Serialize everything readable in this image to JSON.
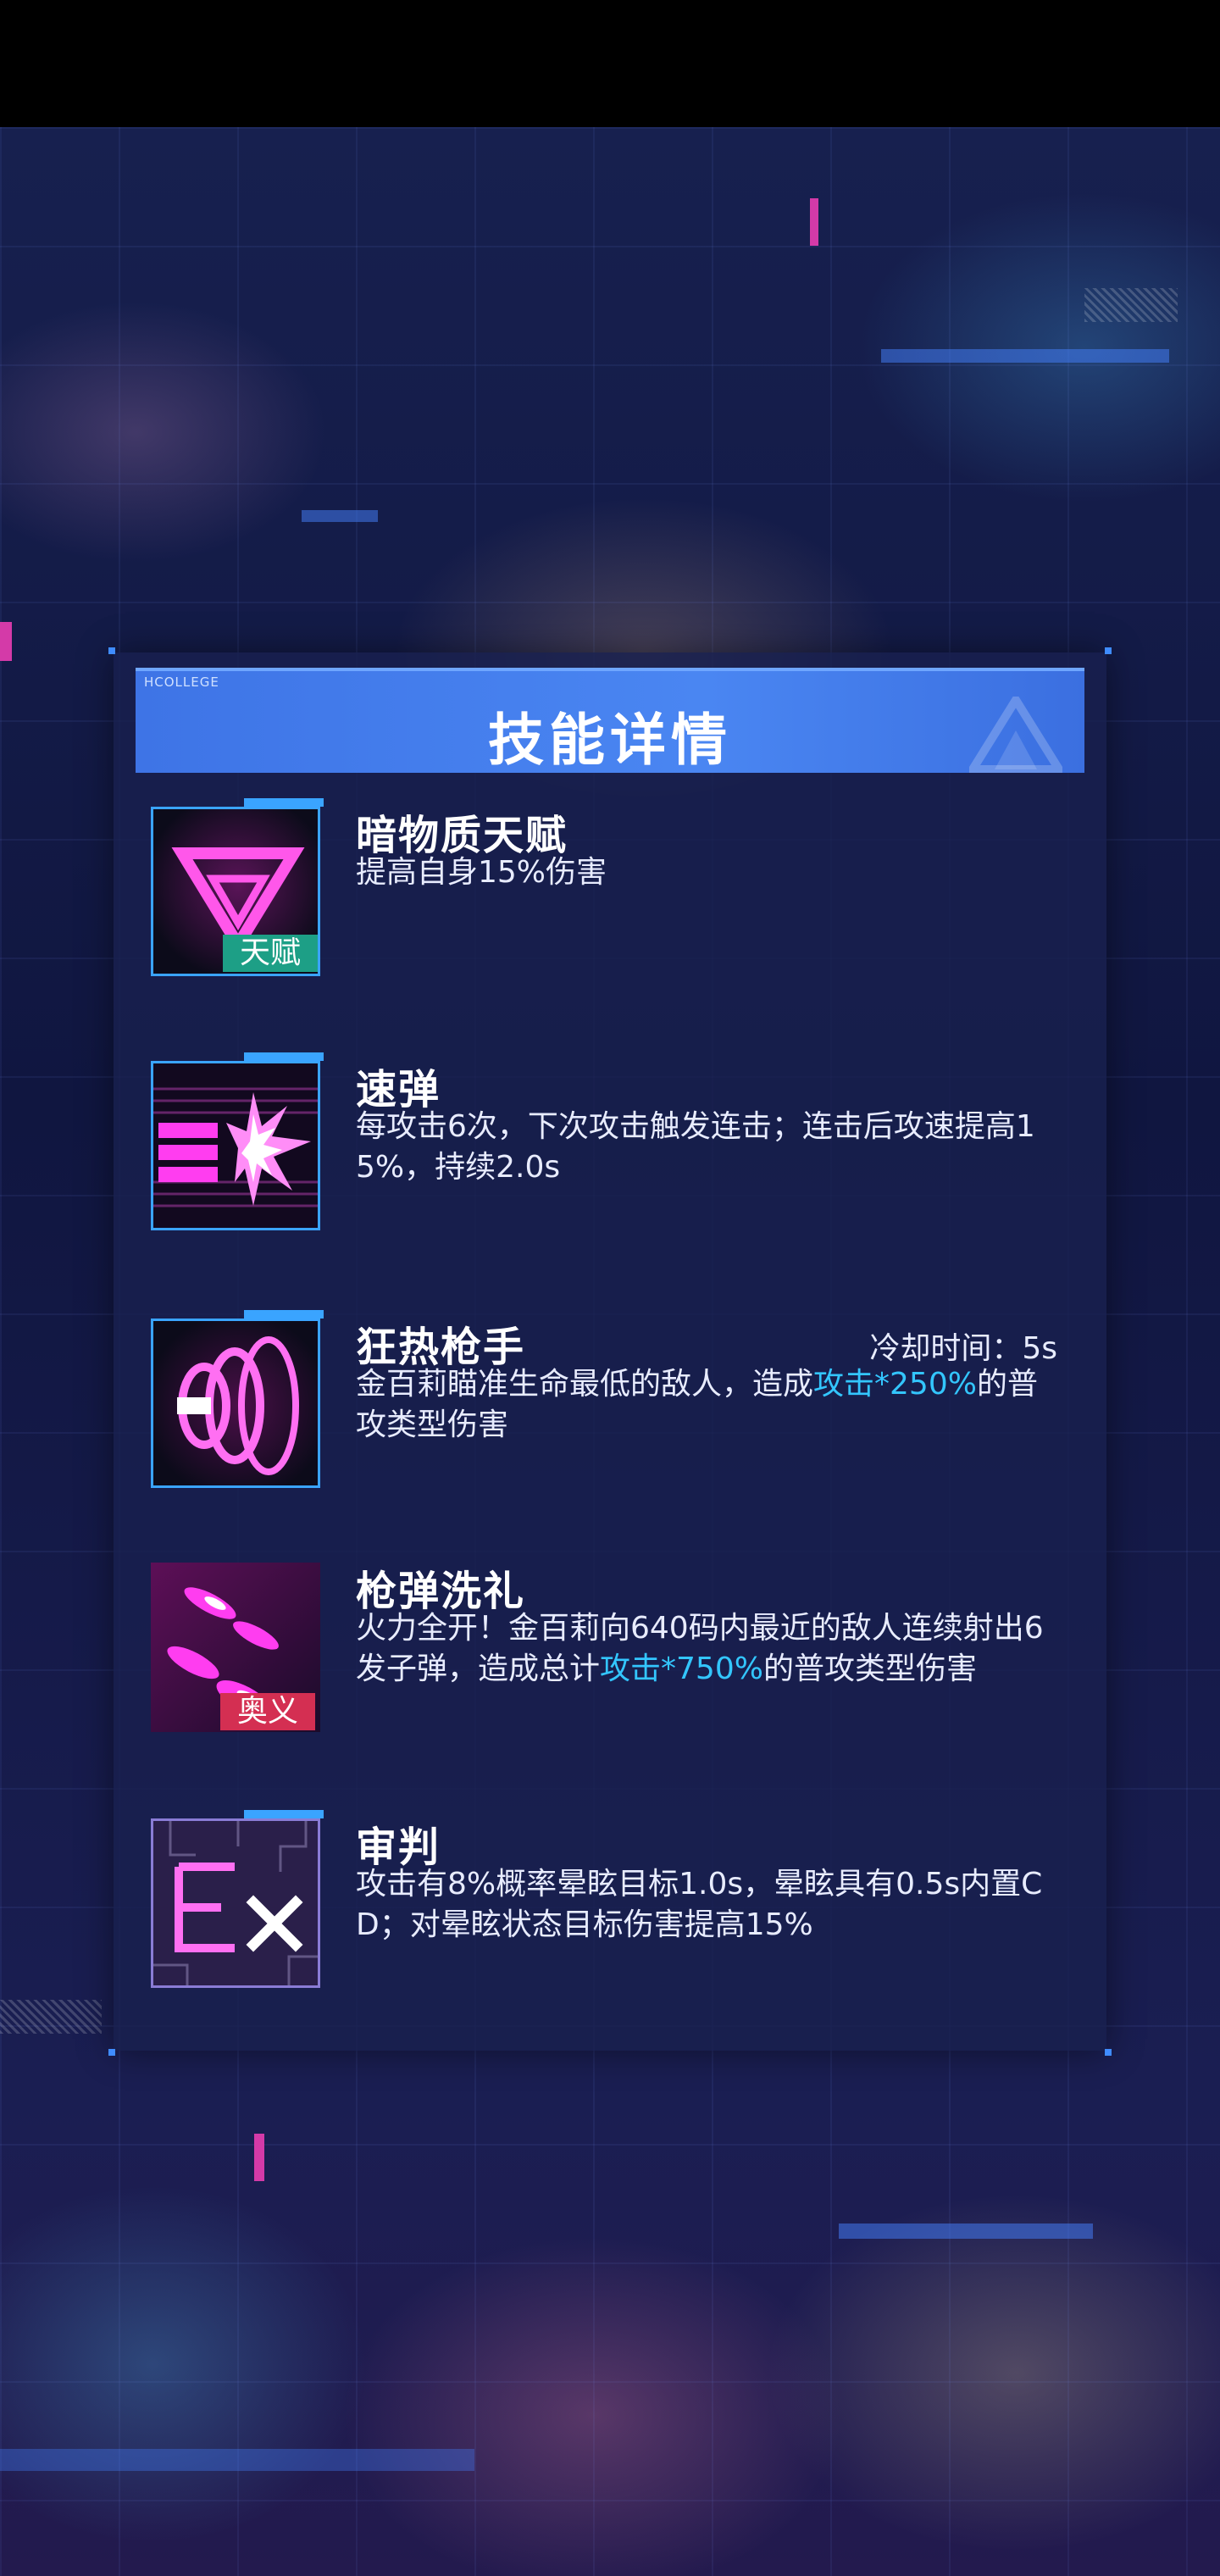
{
  "panel": {
    "brand_tag": "HCOLLEGE",
    "title": "技能详情"
  },
  "skills": [
    {
      "icon": "inverted-triangle-icon",
      "badge": "天赋",
      "name": "暗物质天赋",
      "desc": "提高自身15%伤害"
    },
    {
      "icon": "speed-bullet-icon",
      "name": "速弹",
      "desc": "每攻击6次，下次攻击触发连击；连击后攻速提高15%，持续2.0s"
    },
    {
      "icon": "rapid-gun-icon",
      "name": "狂热枪手",
      "cooldown": "冷却时间：5s",
      "desc_before": "金百莉瞄准生命最低的敌人，造成",
      "desc_highlight": "攻击*250%",
      "desc_after": "的普攻类型伤害"
    },
    {
      "icon": "bullet-storm-icon",
      "badge": "奥义",
      "name": "枪弹洗礼",
      "desc_before": "火力全开！金百莉向640码内最近的敌人连续射出6发子弹，造成总计",
      "desc_highlight": "攻击*750%",
      "desc_after": "的普攻类型伤害"
    },
    {
      "icon": "ex-judgement-icon",
      "name": "审判",
      "desc": "攻击有8%概率晕眩目标1.0s，晕眩具有0.5s内置CD；对晕眩状态目标伤害提高15%"
    }
  ],
  "colors": {
    "header": "#4a86f2",
    "highlight": "#33c6ff",
    "icon_magenta": "#ff3df0",
    "badge_talent": "#1d9f86",
    "badge_ultimate": "#d42f52"
  }
}
